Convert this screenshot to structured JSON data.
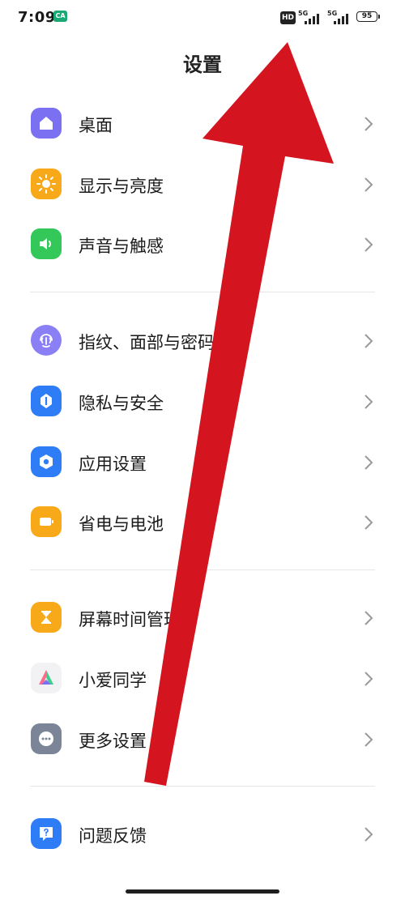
{
  "status_bar": {
    "time": "7:09",
    "app_badge": "CA",
    "hd": "HD",
    "sim1_network": "5G",
    "sim2_network": "5G",
    "battery": "95"
  },
  "title": "设置",
  "sections": [
    [
      {
        "label": "桌面",
        "icon": "home-icon",
        "color": "#7b6ff2"
      },
      {
        "label": "显示与亮度",
        "icon": "sun-icon",
        "color": "#f7a91a"
      },
      {
        "label": "声音与触感",
        "icon": "speaker-icon",
        "color": "#34c759"
      }
    ],
    [
      {
        "label": "指纹、面部与密码",
        "icon": "fingerprint-icon",
        "color": "#8a7ff5"
      },
      {
        "label": "隐私与安全",
        "icon": "privacy-shield-icon",
        "color": "#2f7df6"
      },
      {
        "label": "应用设置",
        "icon": "hexagon-settings-icon",
        "color": "#2f7df6"
      },
      {
        "label": "省电与电池",
        "icon": "battery-icon",
        "color": "#f7a91a"
      }
    ],
    [
      {
        "label": "屏幕时间管理",
        "icon": "hourglass-icon",
        "color": "#f7a91a"
      },
      {
        "label": "小爱同学",
        "icon": "xiaoai-icon",
        "color": "#f2f2f4"
      },
      {
        "label": "更多设置",
        "icon": "more-dots-icon",
        "color": "#7c8597"
      }
    ],
    [
      {
        "label": "问题反馈",
        "icon": "feedback-icon",
        "color": "#2f7df6"
      }
    ]
  ],
  "overlay": {
    "arrow_color": "#d4151f"
  }
}
